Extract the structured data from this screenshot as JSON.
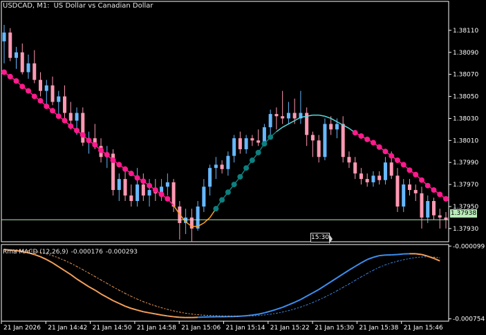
{
  "header": {
    "symbol": "USDCAD, M1:",
    "description": "US Dollar vs Canadian Dollar"
  },
  "subwindow": {
    "indicator": "Rma MACD (12,26,9)",
    "macd_value": "-0.000176",
    "signal_value": "-0.000293"
  },
  "current_price_label": "1.37938",
  "time_tag_label": "15:30",
  "colors": {
    "background": "#000000",
    "frame": "#ffffff",
    "bull_candle": "#66b8ff",
    "bear_candle": "#ff99b3",
    "ma_down": "#ff1a8c",
    "ma_up": "#0e7f7f",
    "ma_up_line": "#55dddd",
    "ma_transition": "#ffa020",
    "price_line": "#b9ecb9",
    "macd_rising": "#3d8ff0",
    "macd_falling": "#f5a05a",
    "signal_line": "#3d8ff0",
    "signal_line_orange": "#f5a05a"
  },
  "chart_data": [
    {
      "type": "candlestick",
      "symbol": "USDCAD",
      "timeframe": "M1",
      "y_ticks": [
        "1.38110",
        "1.38090",
        "1.38070",
        "1.38050",
        "1.38030",
        "1.38010",
        "1.37990",
        "1.37970",
        "1.37950",
        "1.37930"
      ],
      "ylim": [
        1.37918,
        1.38125
      ],
      "current_price": 1.37938,
      "x_labels": [
        "21 Jan 2026",
        "21 Jan 14:42",
        "21 Jan 14:50",
        "21 Jan 14:58",
        "21 Jan 15:06",
        "21 Jan 15:14",
        "21 Jan 15:22",
        "21 Jan 15:30",
        "21 Jan 15:38",
        "21 Jan 15:46"
      ],
      "candles": [
        {
          "o": 1.381,
          "h": 1.38115,
          "l": 1.3808,
          "c": 1.38108
        },
        {
          "o": 1.38108,
          "h": 1.38112,
          "l": 1.38082,
          "c": 1.38085
        },
        {
          "o": 1.38085,
          "h": 1.38095,
          "l": 1.38075,
          "c": 1.3809
        },
        {
          "o": 1.3809,
          "h": 1.38098,
          "l": 1.3807,
          "c": 1.38072
        },
        {
          "o": 1.38072,
          "h": 1.38088,
          "l": 1.38066,
          "c": 1.3808
        },
        {
          "o": 1.3808,
          "h": 1.38092,
          "l": 1.38062,
          "c": 1.38065
        },
        {
          "o": 1.38065,
          "h": 1.38072,
          "l": 1.3805,
          "c": 1.38055
        },
        {
          "o": 1.38055,
          "h": 1.38065,
          "l": 1.3804,
          "c": 1.3806
        },
        {
          "o": 1.3806,
          "h": 1.38068,
          "l": 1.38042,
          "c": 1.38045
        },
        {
          "o": 1.38045,
          "h": 1.38055,
          "l": 1.38032,
          "c": 1.3805
        },
        {
          "o": 1.3805,
          "h": 1.3806,
          "l": 1.3803,
          "c": 1.38035
        },
        {
          "o": 1.38035,
          "h": 1.38045,
          "l": 1.3802,
          "c": 1.38028
        },
        {
          "o": 1.38028,
          "h": 1.3804,
          "l": 1.38015,
          "c": 1.38035
        },
        {
          "o": 1.38035,
          "h": 1.3804,
          "l": 1.38005,
          "c": 1.38008
        },
        {
          "o": 1.38008,
          "h": 1.38018,
          "l": 1.37998,
          "c": 1.38012
        },
        {
          "o": 1.38012,
          "h": 1.38025,
          "l": 1.38002,
          "c": 1.38005
        },
        {
          "o": 1.38005,
          "h": 1.38012,
          "l": 1.3799,
          "c": 1.37995
        },
        {
          "o": 1.37995,
          "h": 1.38005,
          "l": 1.37985,
          "c": 1.37998
        },
        {
          "o": 1.37998,
          "h": 1.38002,
          "l": 1.3796,
          "c": 1.37965
        },
        {
          "o": 1.37965,
          "h": 1.3798,
          "l": 1.37955,
          "c": 1.37975
        },
        {
          "o": 1.37975,
          "h": 1.37985,
          "l": 1.37955,
          "c": 1.3796
        },
        {
          "o": 1.3796,
          "h": 1.3797,
          "l": 1.3795,
          "c": 1.37955
        },
        {
          "o": 1.37955,
          "h": 1.37985,
          "l": 1.3795,
          "c": 1.3797
        },
        {
          "o": 1.3797,
          "h": 1.3798,
          "l": 1.37955,
          "c": 1.3796
        },
        {
          "o": 1.3796,
          "h": 1.37975,
          "l": 1.3795,
          "c": 1.37965
        },
        {
          "o": 1.37965,
          "h": 1.37975,
          "l": 1.37955,
          "c": 1.37962
        },
        {
          "o": 1.37962,
          "h": 1.37975,
          "l": 1.37955,
          "c": 1.37968
        },
        {
          "o": 1.37968,
          "h": 1.3798,
          "l": 1.3796,
          "c": 1.37972
        },
        {
          "o": 1.37972,
          "h": 1.37975,
          "l": 1.37945,
          "c": 1.3795
        },
        {
          "o": 1.3795,
          "h": 1.37955,
          "l": 1.3792,
          "c": 1.37935
        },
        {
          "o": 1.37935,
          "h": 1.37948,
          "l": 1.37925,
          "c": 1.3794
        },
        {
          "o": 1.3794,
          "h": 1.37948,
          "l": 1.37918,
          "c": 1.3793
        },
        {
          "o": 1.3793,
          "h": 1.37955,
          "l": 1.37928,
          "c": 1.3795
        },
        {
          "o": 1.3795,
          "h": 1.37975,
          "l": 1.37945,
          "c": 1.37968
        },
        {
          "o": 1.37968,
          "h": 1.37988,
          "l": 1.3796,
          "c": 1.37985
        },
        {
          "o": 1.37985,
          "h": 1.37995,
          "l": 1.37975,
          "c": 1.37988
        },
        {
          "o": 1.37988,
          "h": 1.37992,
          "l": 1.3798,
          "c": 1.37984
        },
        {
          "o": 1.37984,
          "h": 1.38,
          "l": 1.37978,
          "c": 1.37996
        },
        {
          "o": 1.37996,
          "h": 1.38015,
          "l": 1.3799,
          "c": 1.38012
        },
        {
          "o": 1.38012,
          "h": 1.38018,
          "l": 1.37998,
          "c": 1.38002
        },
        {
          "o": 1.38002,
          "h": 1.38015,
          "l": 1.37998,
          "c": 1.38012
        },
        {
          "o": 1.38012,
          "h": 1.38015,
          "l": 1.38005,
          "c": 1.3801
        },
        {
          "o": 1.3801,
          "h": 1.3802,
          "l": 1.38005,
          "c": 1.38008
        },
        {
          "o": 1.38008,
          "h": 1.38025,
          "l": 1.38005,
          "c": 1.38022
        },
        {
          "o": 1.38022,
          "h": 1.38038,
          "l": 1.38012,
          "c": 1.38034
        },
        {
          "o": 1.38034,
          "h": 1.3804,
          "l": 1.3802,
          "c": 1.38032
        },
        {
          "o": 1.38032,
          "h": 1.38055,
          "l": 1.38025,
          "c": 1.3803
        },
        {
          "o": 1.3803,
          "h": 1.38045,
          "l": 1.38025,
          "c": 1.38035
        },
        {
          "o": 1.38035,
          "h": 1.38048,
          "l": 1.38025,
          "c": 1.3803
        },
        {
          "o": 1.3803,
          "h": 1.38055,
          "l": 1.38025,
          "c": 1.38035
        },
        {
          "o": 1.38035,
          "h": 1.3804,
          "l": 1.38005,
          "c": 1.38015
        },
        {
          "o": 1.38015,
          "h": 1.38018,
          "l": 1.37995,
          "c": 1.3801
        },
        {
          "o": 1.3801,
          "h": 1.38015,
          "l": 1.3799,
          "c": 1.37995
        },
        {
          "o": 1.37995,
          "h": 1.3803,
          "l": 1.37992,
          "c": 1.38025
        },
        {
          "o": 1.38025,
          "h": 1.38032,
          "l": 1.38015,
          "c": 1.3802
        },
        {
          "o": 1.3802,
          "h": 1.3803,
          "l": 1.38012,
          "c": 1.38025
        },
        {
          "o": 1.38025,
          "h": 1.38032,
          "l": 1.3799,
          "c": 1.37995
        },
        {
          "o": 1.37995,
          "h": 1.38,
          "l": 1.37985,
          "c": 1.3799
        },
        {
          "o": 1.3799,
          "h": 1.37995,
          "l": 1.37975,
          "c": 1.3798
        },
        {
          "o": 1.3798,
          "h": 1.37985,
          "l": 1.3797,
          "c": 1.37975
        },
        {
          "o": 1.37975,
          "h": 1.3798,
          "l": 1.37968,
          "c": 1.37972
        },
        {
          "o": 1.37972,
          "h": 1.37982,
          "l": 1.37968,
          "c": 1.37978
        },
        {
          "o": 1.37978,
          "h": 1.37982,
          "l": 1.3797,
          "c": 1.37974
        },
        {
          "o": 1.37974,
          "h": 1.37995,
          "l": 1.3797,
          "c": 1.3799
        },
        {
          "o": 1.3799,
          "h": 1.38,
          "l": 1.37975,
          "c": 1.37978
        },
        {
          "o": 1.37978,
          "h": 1.37985,
          "l": 1.37945,
          "c": 1.3795
        },
        {
          "o": 1.3795,
          "h": 1.37975,
          "l": 1.37945,
          "c": 1.3797
        },
        {
          "o": 1.3797,
          "h": 1.37975,
          "l": 1.3796,
          "c": 1.37965
        },
        {
          "o": 1.37965,
          "h": 1.3797,
          "l": 1.37955,
          "c": 1.37962
        },
        {
          "o": 1.37962,
          "h": 1.37968,
          "l": 1.3793,
          "c": 1.3794
        },
        {
          "o": 1.3794,
          "h": 1.3796,
          "l": 1.37935,
          "c": 1.37955
        },
        {
          "o": 1.37955,
          "h": 1.37958,
          "l": 1.37938,
          "c": 1.37942
        },
        {
          "o": 1.37942,
          "h": 1.37948,
          "l": 1.3793,
          "c": 1.3794
        },
        {
          "o": 1.3794,
          "h": 1.37945,
          "l": 1.3793,
          "c": 1.37938
        }
      ],
      "moving_average": {
        "values": [
          1.38072,
          1.38068,
          1.38064,
          1.38059,
          1.38055,
          1.3805,
          1.38046,
          1.38041,
          1.38037,
          1.38032,
          1.38028,
          1.38023,
          1.38019,
          1.38015,
          1.3801,
          1.38006,
          1.38001,
          1.37997,
          1.37992,
          1.37988,
          1.37984,
          1.3798,
          1.37976,
          1.37973,
          1.37969,
          1.37965,
          1.37961,
          1.37957,
          1.37951,
          1.37943,
          1.37936,
          1.37932,
          1.37932,
          1.37935,
          1.3794,
          1.37948,
          1.37956,
          1.37963,
          1.3797,
          1.37977,
          1.37985,
          1.37992,
          1.37999,
          1.38007,
          1.38013,
          1.38018,
          1.38022,
          1.38025,
          1.38028,
          1.38031,
          1.38032,
          1.38033,
          1.38033,
          1.38032,
          1.3803,
          1.38027,
          1.38024,
          1.38021,
          1.38017,
          1.38014,
          1.38011,
          1.38008,
          1.38004,
          1.38,
          1.37996,
          1.37992,
          1.37988,
          1.37983,
          1.37979,
          1.37974,
          1.37969,
          1.37965,
          1.37961,
          1.37957
        ],
        "state": [
          "down",
          "down",
          "down",
          "down",
          "down",
          "down",
          "down",
          "down",
          "down",
          "down",
          "down",
          "down",
          "down",
          "down",
          "down",
          "down",
          "down",
          "down",
          "down",
          "down",
          "down",
          "down",
          "down",
          "down",
          "down",
          "down",
          "down",
          "down",
          "flat",
          "flat",
          "flat",
          "flat",
          "flat",
          "flat",
          "flat",
          "up",
          "up",
          "up",
          "up",
          "up",
          "up",
          "up",
          "up",
          "up",
          "up",
          "upline",
          "upline",
          "upline",
          "upline",
          "upline",
          "upline",
          "upline",
          "upline",
          "upline",
          "upline",
          "upline",
          "upline",
          "upline",
          "down",
          "down",
          "down",
          "down",
          "down",
          "down",
          "down",
          "down",
          "down",
          "down",
          "down",
          "down",
          "down",
          "down",
          "down",
          "down"
        ]
      }
    },
    {
      "type": "line",
      "indicator": "Rma MACD (12,26,9)",
      "y_ticks": [
        "-0.000099",
        "-0.000754"
      ],
      "ylim": [
        -0.000775,
        -8.5e-05
      ],
      "series": [
        {
          "values": [
            -0.00013,
            -0.000135,
            -0.00014,
            -0.000148,
            -0.00016,
            -0.000175,
            -0.000195,
            -0.00022,
            -0.00025,
            -0.000285,
            -0.00032,
            -0.000355,
            -0.000395,
            -0.00043,
            -0.000465,
            -0.000495,
            -0.00053,
            -0.00056,
            -0.00059,
            -0.000615,
            -0.00064,
            -0.00066,
            -0.000675,
            -0.00069,
            -0.0007,
            -0.00071,
            -0.00072,
            -0.000728,
            -0.000735,
            -0.00074,
            -0.000742,
            -0.000742,
            -0.00074,
            -0.000738,
            -0.000736,
            -0.000735,
            -0.000735,
            -0.000734,
            -0.000733,
            -0.00073,
            -0.000726,
            -0.00072,
            -0.000712,
            -0.0007,
            -0.000685,
            -0.000668,
            -0.00065,
            -0.000628,
            -0.000605,
            -0.00058,
            -0.00055,
            -0.00052,
            -0.00049,
            -0.000455,
            -0.00042,
            -0.000385,
            -0.00035,
            -0.000315,
            -0.000282,
            -0.00025,
            -0.00022,
            -0.0002,
            -0.000185,
            -0.00018,
            -0.000178,
            -0.000175,
            -0.00017,
            -0.000168,
            -0.000168,
            -0.000175,
            -0.00019,
            -0.00021,
            -0.000232
          ],
          "state": [
            "fall",
            "fall",
            "fall",
            "fall",
            "fall",
            "fall",
            "fall",
            "fall",
            "fall",
            "fall",
            "fall",
            "fall",
            "fall",
            "fall",
            "fall",
            "fall",
            "fall",
            "fall",
            "fall",
            "fall",
            "fall",
            "fall",
            "fall",
            "fall",
            "fall",
            "fall",
            "fall",
            "fall",
            "fall",
            "fall",
            "fall",
            "fall",
            "rise",
            "rise",
            "rise",
            "rise",
            "rise",
            "rise",
            "rise",
            "rise",
            "rise",
            "rise",
            "rise",
            "rise",
            "rise",
            "rise",
            "rise",
            "rise",
            "rise",
            "rise",
            "rise",
            "rise",
            "rise",
            "rise",
            "rise",
            "rise",
            "rise",
            "rise",
            "rise",
            "rise",
            "rise",
            "rise",
            "rise",
            "rise",
            "rise",
            "rise",
            "rise",
            "fall",
            "fall",
            "fall",
            "fall",
            "fall",
            "fall"
          ]
        }
      ]
    }
  ]
}
